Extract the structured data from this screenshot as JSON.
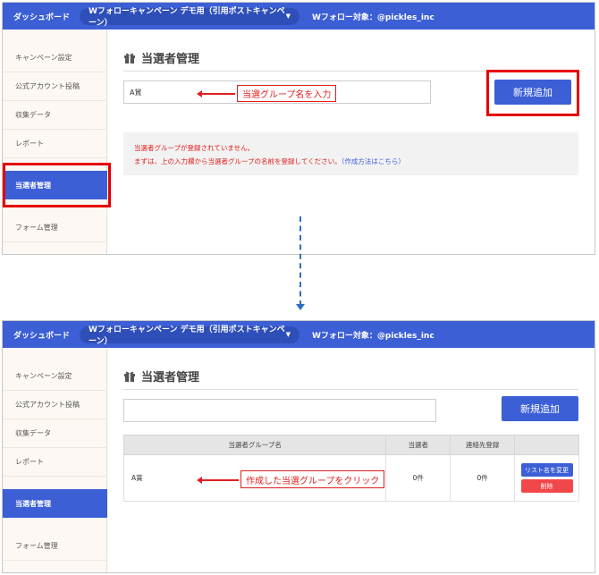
{
  "topbar": {
    "dashboard": "ダッシュボード",
    "campaign": "Wフォローキャンペーン デモ用（引用ポストキャンペーン）",
    "target": "Wフォロー対象：@pickles_inc"
  },
  "sidebar": {
    "items": [
      {
        "label": "キャンペーン設定"
      },
      {
        "label": "公式アカウント投稿"
      },
      {
        "label": "収集データ"
      },
      {
        "label": "レポート"
      },
      {
        "label": "当選者管理"
      },
      {
        "label": "フォーム管理"
      }
    ]
  },
  "main": {
    "title": "当選者管理",
    "add_button": "新規追加"
  },
  "step1": {
    "input_value": "A賞",
    "callout": "当選グループ名を入力",
    "notice_line1": "当選者グループが登録されていません。",
    "notice_line2": "まずは、上の入力欄から当選者グループの名前を登録してください。",
    "notice_link": "（作成方法はこちら）"
  },
  "step2": {
    "input_value": "",
    "table": {
      "headers": [
        "当選者グループ名",
        "当選者",
        "連絡先登録",
        ""
      ],
      "rows": [
        {
          "name": "A賞",
          "winners": "0件",
          "contacts": "0件",
          "rename": "リスト名を変更",
          "delete": "削除"
        }
      ]
    },
    "callout": "作成した当選グループをクリック"
  },
  "colors": {
    "brand": "#3c5fd6",
    "highlight": "#e60000",
    "delete": "#f2474a",
    "sidebar_bg": "#fdf8f3"
  }
}
